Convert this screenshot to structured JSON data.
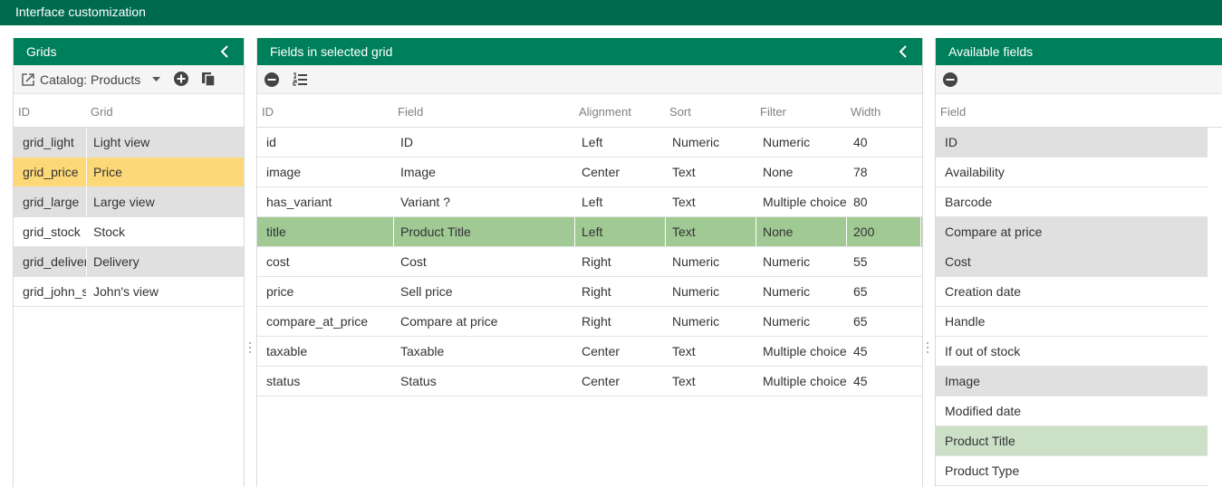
{
  "app": {
    "title": "Interface customization"
  },
  "grids_panel": {
    "title": "Grids",
    "catalog_select": "Catalog: Products",
    "columns": [
      "ID",
      "Grid"
    ],
    "rows": [
      {
        "id": "grid_light",
        "grid": "Light view",
        "state": "grey"
      },
      {
        "id": "grid_price",
        "grid": "Price",
        "state": "yellow"
      },
      {
        "id": "grid_large",
        "grid": "Large view",
        "state": "grey"
      },
      {
        "id": "grid_stock",
        "grid": "Stock",
        "state": ""
      },
      {
        "id": "grid_delivery",
        "grid": "Delivery",
        "state": "grey"
      },
      {
        "id": "grid_john_s",
        "grid": "John's view",
        "state": ""
      }
    ]
  },
  "fields_panel": {
    "title": "Fields in selected grid",
    "columns": [
      "ID",
      "Field",
      "Alignment",
      "Sort",
      "Filter",
      "Width"
    ],
    "rows": [
      {
        "id": "id",
        "field": "ID",
        "alignment": "Left",
        "sort": "Numeric",
        "filter": "Numeric",
        "width": "40",
        "state": ""
      },
      {
        "id": "image",
        "field": "Image",
        "alignment": "Center",
        "sort": "Text",
        "filter": "None",
        "width": "78",
        "state": ""
      },
      {
        "id": "has_variant",
        "field": "Variant ?",
        "alignment": "Left",
        "sort": "Text",
        "filter": "Multiple choice",
        "width": "80",
        "state": ""
      },
      {
        "id": "title",
        "field": "Product Title",
        "alignment": "Left",
        "sort": "Text",
        "filter": "None",
        "width": "200",
        "state": "green"
      },
      {
        "id": "cost",
        "field": "Cost",
        "alignment": "Right",
        "sort": "Numeric",
        "filter": "Numeric",
        "width": "55",
        "state": ""
      },
      {
        "id": "price",
        "field": "Sell price",
        "alignment": "Right",
        "sort": "Numeric",
        "filter": "Numeric",
        "width": "65",
        "state": ""
      },
      {
        "id": "compare_at_price",
        "field": "Compare at price",
        "alignment": "Right",
        "sort": "Numeric",
        "filter": "Numeric",
        "width": "65",
        "state": ""
      },
      {
        "id": "taxable",
        "field": "Taxable",
        "alignment": "Center",
        "sort": "Text",
        "filter": "Multiple choice",
        "width": "45",
        "state": ""
      },
      {
        "id": "status",
        "field": "Status",
        "alignment": "Center",
        "sort": "Text",
        "filter": "Multiple choice",
        "width": "45",
        "state": ""
      }
    ]
  },
  "available_panel": {
    "title": "Available fields",
    "columns": [
      "Field"
    ],
    "rows": [
      {
        "field": "ID",
        "state": "grey"
      },
      {
        "field": "Availability",
        "state": ""
      },
      {
        "field": "Barcode",
        "state": ""
      },
      {
        "field": "Compare at price",
        "state": "grey"
      },
      {
        "field": "Cost",
        "state": "grey"
      },
      {
        "field": "Creation date",
        "state": ""
      },
      {
        "field": "Handle",
        "state": ""
      },
      {
        "field": "If out of stock",
        "state": ""
      },
      {
        "field": "Image",
        "state": "grey"
      },
      {
        "field": "Modified date",
        "state": ""
      },
      {
        "field": "Product Title",
        "state": "lightgreen"
      },
      {
        "field": "Product Type",
        "state": ""
      }
    ]
  },
  "icons": {
    "collapse": "chevron-left-icon",
    "open_external": "external-link-icon",
    "dropdown": "caret-down-icon",
    "add": "plus-circle-icon",
    "copy": "copy-icon",
    "remove": "minus-circle-icon",
    "list": "ordered-list-icon"
  },
  "colors": {
    "title_bar": "#006a4e",
    "panel_header": "#00805a",
    "row_grey": "#e0e0e0",
    "row_selected_yellow": "#fdd878",
    "row_selected_green": "#a0c994",
    "row_light_green": "#cce0c8"
  }
}
